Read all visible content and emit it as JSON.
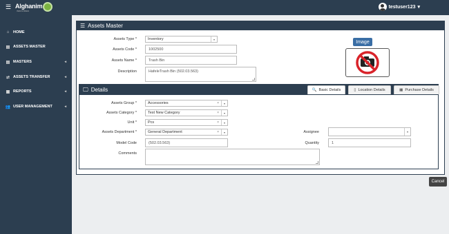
{
  "topbar": {
    "menu_glyph": "☰",
    "logo": "Alghanim",
    "logo_sub": "INDUSTRIES",
    "username": "testuser123",
    "user_caret": "▾"
  },
  "sidebar": {
    "items": [
      {
        "label": "HOME",
        "icon": "home-icon",
        "glyph": "⌂",
        "arrow": ""
      },
      {
        "label": "ASSETS MASTER",
        "icon": "list-icon",
        "glyph": "▤",
        "arrow": ""
      },
      {
        "label": "MASTERS",
        "icon": "list-icon",
        "glyph": "▤",
        "arrow": "◂"
      },
      {
        "label": "ASSETS TRANSFER",
        "icon": "transfer-icon",
        "glyph": "⇄",
        "arrow": "◂"
      },
      {
        "label": "REPORTS",
        "icon": "chart-icon",
        "glyph": "▦",
        "arrow": "◂"
      },
      {
        "label": "USER MANAGEMENT",
        "icon": "users-icon",
        "glyph": "👥",
        "arrow": "◂"
      }
    ]
  },
  "assets_master": {
    "title": "Assets Master",
    "type_label": "Assets Type *",
    "type_value": "Inventory",
    "code_label": "Assets Code *",
    "code_value": "1002500",
    "name_label": "Assets Name *",
    "name_value": "Trash Bin",
    "desc_label": "Description",
    "desc_value": "HafeleTrash Bin (502.03.563)",
    "image_label": "Image"
  },
  "details": {
    "title": "Details",
    "tabs": [
      {
        "label": "Basic Details",
        "icon": "search-icon",
        "glyph": "🔍"
      },
      {
        "label": "Location Details",
        "icon": "document-icon",
        "glyph": "▯"
      },
      {
        "label": "Purchase Details",
        "icon": "chart-icon",
        "glyph": "▦"
      }
    ],
    "group_label": "Assets Group *",
    "group_value": "Accessories",
    "category_label": "Assets Category *",
    "category_value": "Test New Category",
    "unit_label": "Unit *",
    "unit_value": "Pcs",
    "dept_label": "Assets Department *",
    "dept_value": "General Department",
    "model_label": "Model Code",
    "model_value": "(502.03.563)",
    "comments_label": "Comments",
    "comments_value": "",
    "assignee_label": "Assignee",
    "assignee_value": "",
    "quantity_label": "Quantity",
    "quantity_value": "1",
    "clear_glyph": "×",
    "caret_glyph": "▾"
  },
  "actions": {
    "cancel_label": "Cancel"
  },
  "colors": {
    "sidebar": "#2c3e50",
    "accent": "#3a6ea5",
    "no_camera_red": "#d9232a"
  }
}
